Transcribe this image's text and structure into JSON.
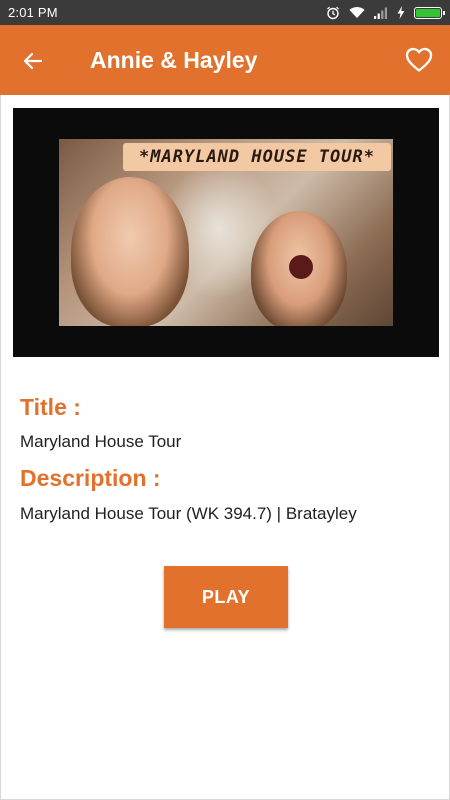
{
  "status_bar": {
    "time": "2:01 PM",
    "icons": [
      "alarm-icon",
      "wifi-icon",
      "signal-icon",
      "charging-icon",
      "battery-icon"
    ]
  },
  "app_bar": {
    "title": "Annie & Hayley",
    "back_icon": "arrow-back-icon",
    "favorite_icon": "heart-outline-icon",
    "color": "#e2712d"
  },
  "video": {
    "thumbnail_text": "*MARYLAND HOUSE TOUR*"
  },
  "details": {
    "title_label": "Title :",
    "title_value": "Maryland House Tour",
    "description_label": "Description :",
    "description_value": "Maryland House Tour (WK 394.7) | Bratayley"
  },
  "actions": {
    "play_label": "PLAY"
  }
}
